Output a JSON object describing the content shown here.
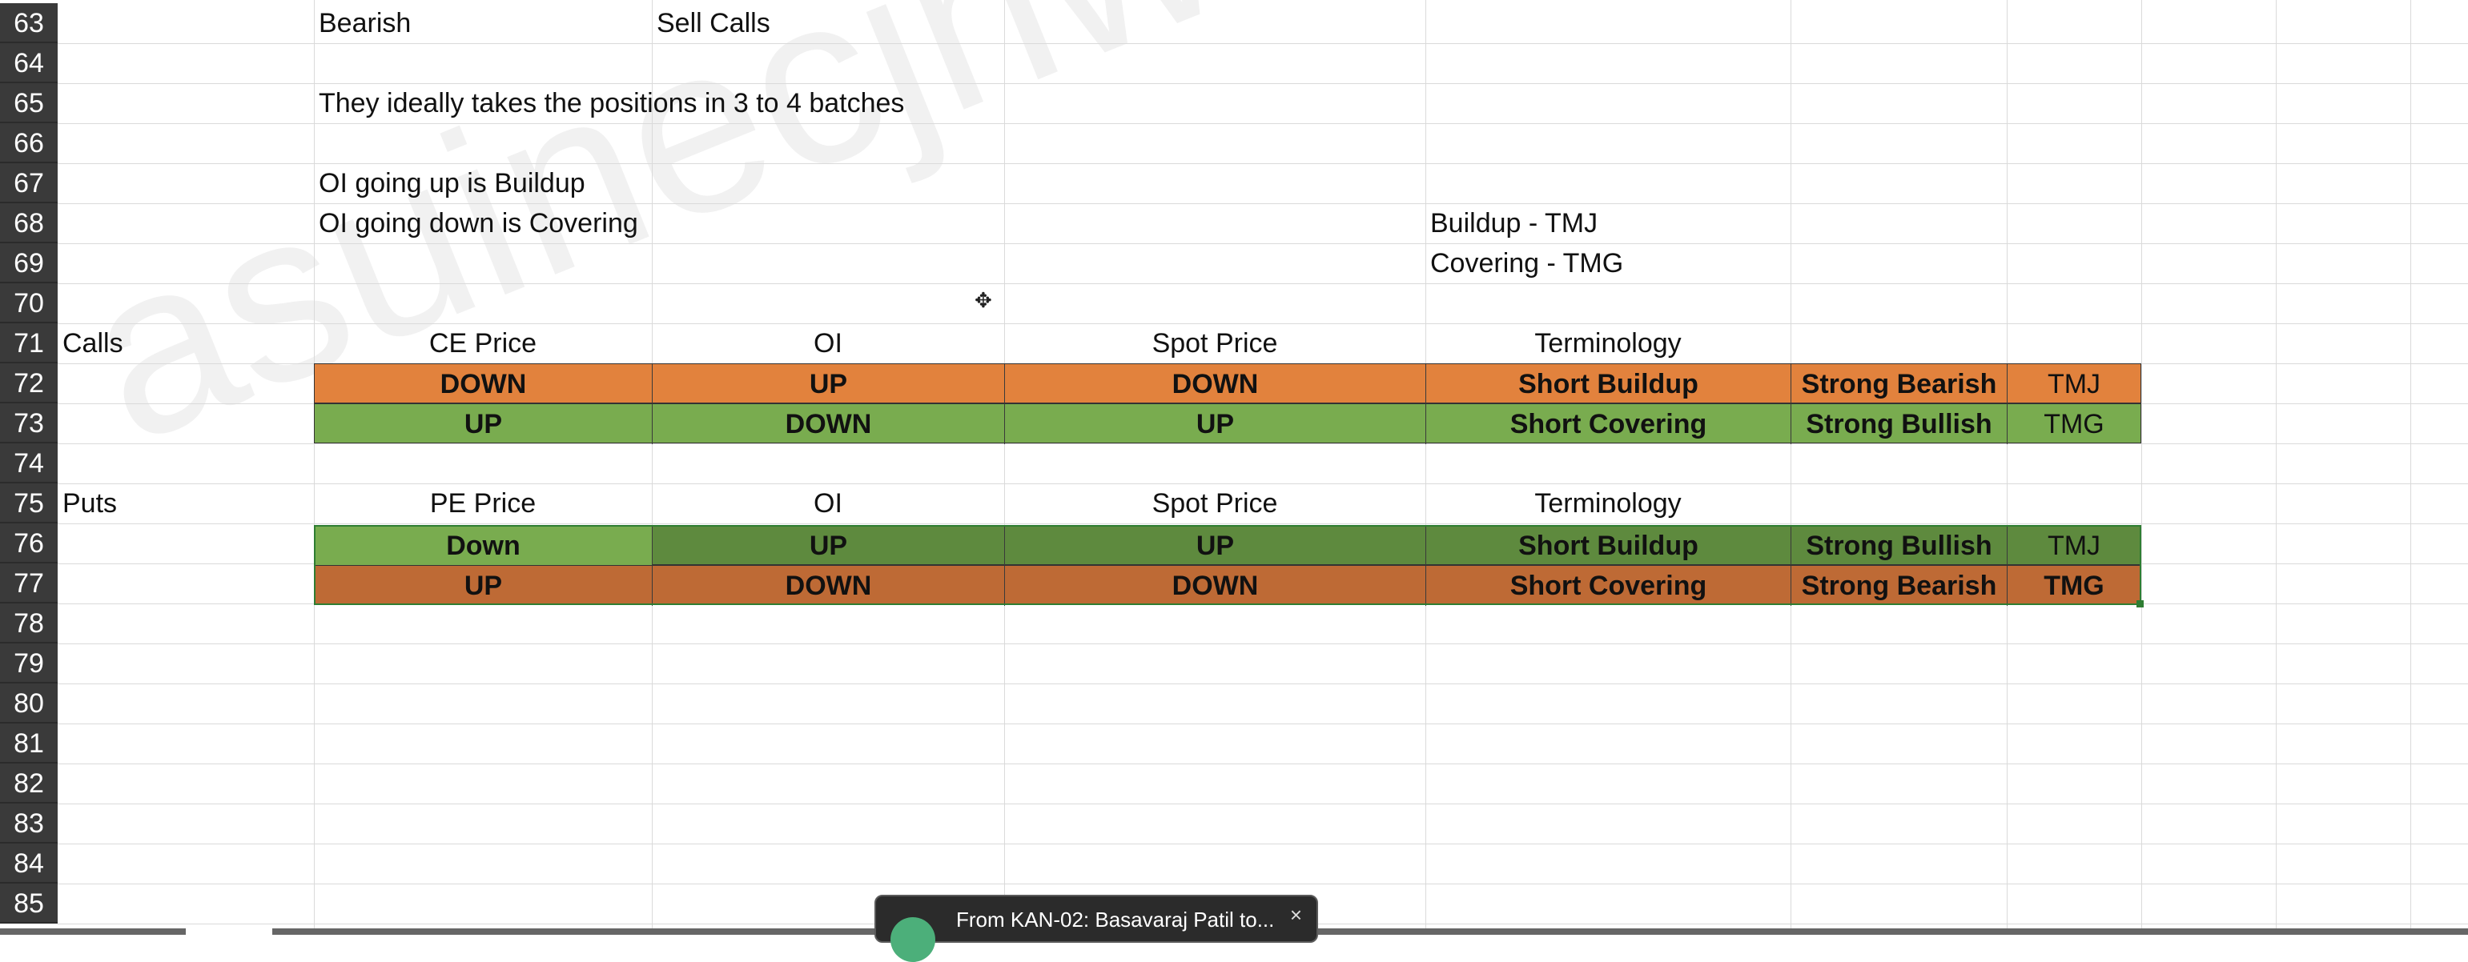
{
  "rows": [
    "63",
    "64",
    "65",
    "66",
    "67",
    "68",
    "69",
    "70",
    "71",
    "72",
    "73",
    "74",
    "75",
    "76",
    "77",
    "78",
    "79",
    "80",
    "81",
    "82",
    "83",
    "84",
    "85"
  ],
  "notes": {
    "r63_a": "Bearish",
    "r63_b": "Sell Calls",
    "r65": "They ideally takes the positions in 3 to 4 batches",
    "r67": "OI going up is Buildup",
    "r68": "OI going down is Covering",
    "r68_right": "Buildup - TMJ",
    "r69_right": "Covering - TMG"
  },
  "calls": {
    "label": "Calls",
    "headers": [
      "CE Price",
      "OI",
      "Spot Price",
      "Terminology"
    ],
    "rows": [
      {
        "cells": [
          "DOWN",
          "UP",
          "DOWN",
          "Short Buildup",
          "Strong Bearish",
          "TMJ"
        ],
        "color": "#e2823d"
      },
      {
        "cells": [
          "UP",
          "DOWN",
          "UP",
          "Short Covering",
          "Strong Bullish",
          "TMG"
        ],
        "color": "#79ac4f"
      }
    ]
  },
  "puts": {
    "label": "Puts",
    "headers": [
      "PE Price",
      "OI",
      "Spot Price",
      "Terminology"
    ],
    "rows": [
      {
        "cells": [
          "Down",
          "UP",
          "UP",
          "Short Buildup",
          "Strong Bullish",
          "TMJ"
        ],
        "first_color": "#79ac4f",
        "color": "#5e8a3e"
      },
      {
        "cells": [
          "UP",
          "DOWN",
          "DOWN",
          "Short Covering",
          "Strong Bearish",
          "TMG"
        ],
        "first_color": "#be6a35",
        "color": "#be6a35"
      }
    ]
  },
  "watermark": "asuinecjnwegmail.com",
  "notification": {
    "text": "From KAN-02: Basavaraj Patil to...",
    "close": "×"
  },
  "colors": {
    "row_header_bg": "#3a3a3a",
    "grid": "#dadada",
    "selection": "#2e7d32"
  }
}
